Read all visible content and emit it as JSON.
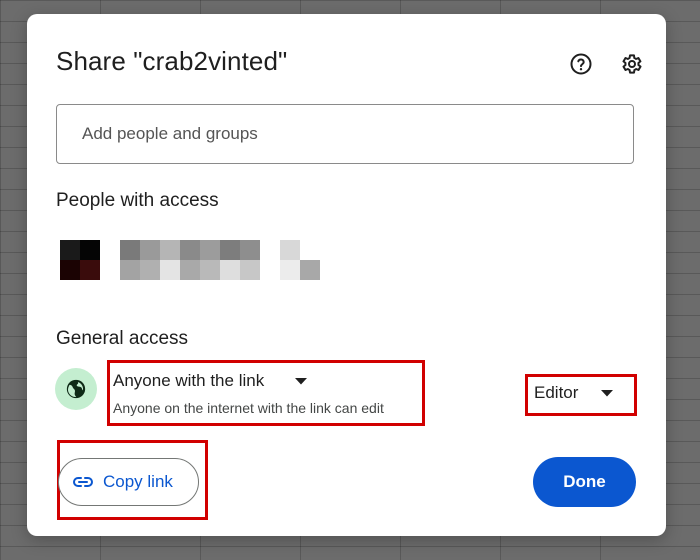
{
  "dialog": {
    "title": "Share \"crab2vinted\"",
    "help_icon": "help-circle-icon",
    "settings_icon": "gear-icon"
  },
  "add_people": {
    "placeholder": "Add people and groups",
    "value": ""
  },
  "people_with_access": {
    "heading": "People with access"
  },
  "general_access": {
    "heading": "General access",
    "icon": "globe-icon",
    "selected_option": "Anyone with the link",
    "description": "Anyone on the internet with the link can edit",
    "role": "Editor"
  },
  "actions": {
    "copy_link_label": "Copy link",
    "copy_link_icon": "link-icon",
    "done_label": "Done"
  },
  "colors": {
    "primary": "#0b57d0",
    "highlight": "#d10000",
    "globe_bg": "#c4eed0"
  }
}
